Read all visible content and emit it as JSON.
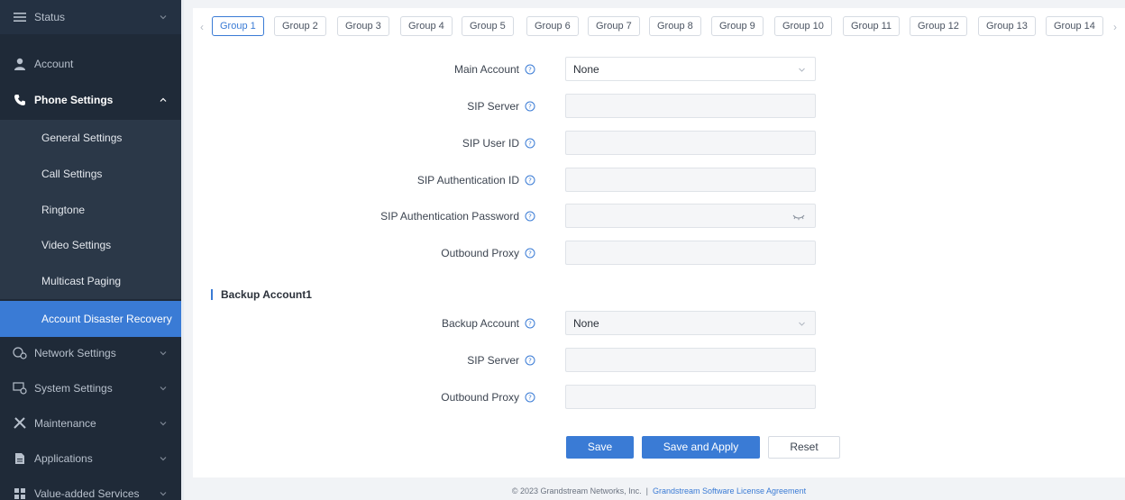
{
  "sidebar": {
    "items": [
      {
        "label": "Status",
        "icon": "list-icon"
      },
      {
        "label": "Account",
        "icon": "user-icon"
      },
      {
        "label": "Phone Settings",
        "icon": "phone-icon"
      },
      {
        "label": "Network Settings",
        "icon": "network-gear-icon"
      },
      {
        "label": "System Settings",
        "icon": "monitor-gear-icon"
      },
      {
        "label": "Maintenance",
        "icon": "tools-icon"
      },
      {
        "label": "Applications",
        "icon": "document-icon"
      },
      {
        "label": "Value-added Services",
        "icon": "grid-icon"
      }
    ],
    "phone_settings_sub": [
      "General Settings",
      "Call Settings",
      "Ringtone",
      "Video Settings",
      "Multicast Paging",
      "Account Disaster Recovery"
    ]
  },
  "tabs": [
    "Group 1",
    "Group 2",
    "Group 3",
    "Group 4",
    "Group 5",
    "Group 6",
    "Group 7",
    "Group 8",
    "Group 9",
    "Group 10",
    "Group 11",
    "Group 12",
    "Group 13",
    "Group 14"
  ],
  "form": {
    "main_account": {
      "label": "Main Account",
      "value": "None"
    },
    "sip_server": {
      "label": "SIP Server",
      "value": ""
    },
    "sip_user_id": {
      "label": "SIP User ID",
      "value": ""
    },
    "sip_auth_id": {
      "label": "SIP Authentication ID",
      "value": ""
    },
    "sip_auth_password": {
      "label": "SIP Authentication Password",
      "value": ""
    },
    "outbound_proxy": {
      "label": "Outbound Proxy",
      "value": ""
    },
    "backup_section_title": "Backup Account1",
    "backup_account": {
      "label": "Backup Account",
      "value": "None"
    },
    "backup_sip_server": {
      "label": "SIP Server",
      "value": ""
    },
    "backup_outbound_proxy": {
      "label": "Outbound Proxy",
      "value": ""
    }
  },
  "buttons": {
    "save": "Save",
    "save_apply": "Save and Apply",
    "reset": "Reset"
  },
  "footer": {
    "copyright": "© 2023 Grandstream Networks, Inc.",
    "separator": "|",
    "license_link": "Grandstream Software License Agreement"
  },
  "colors": {
    "accent": "#3a7bd5",
    "sidebar_bg": "#1f2a38"
  }
}
